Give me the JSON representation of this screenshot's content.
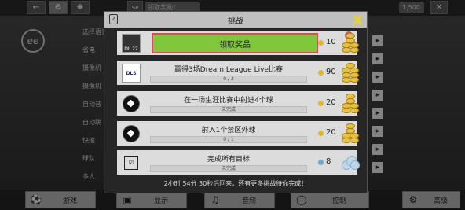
{
  "topbar": {
    "chip_label": "领取奖励！",
    "sp_badge": "SP",
    "currency_value": "1,500"
  },
  "logo": {
    "text": "ee"
  },
  "sidebar": {
    "items": [
      {
        "label": "选择语言"
      },
      {
        "label": "省电"
      },
      {
        "label": "摄像机"
      },
      {
        "label": "摄像机"
      },
      {
        "label": "自动音"
      },
      {
        "label": "自动跳"
      },
      {
        "label": "快速"
      },
      {
        "label": "球队"
      },
      {
        "label": "多人"
      }
    ]
  },
  "bottom_tabs": [
    {
      "label": "游戏",
      "icon": "football-icon"
    },
    {
      "label": "显示",
      "icon": "monitor-icon"
    },
    {
      "label": "音频",
      "icon": "music-icon"
    },
    {
      "label": "控制",
      "icon": "gamepad-icon"
    },
    {
      "label": "高级",
      "icon": "gear-icon"
    }
  ],
  "modal": {
    "title": "挑战",
    "close_label": "X",
    "footer": "2小时 54分 30秒后回来，还有更多挑战待你完成！",
    "challenges": [
      {
        "type": "claim",
        "button_label": "领取奖品",
        "badge": "!",
        "icon_text": "DL 22",
        "reward": "10",
        "reward_kind": "coin"
      },
      {
        "title": "赢得3场Dream League Live比赛",
        "progress": "0 / 3",
        "progress_fraction": 0,
        "icon_text": "DLS",
        "reward": "90",
        "reward_kind": "coin"
      },
      {
        "title": "在一场生涯比赛中射进4个球",
        "progress": "未完成",
        "progress_fraction": 0,
        "reward": "20",
        "reward_kind": "coin"
      },
      {
        "title": "射入1个禁区外球",
        "progress": "0 / 1",
        "progress_fraction": 0,
        "reward": "20",
        "reward_kind": "coin"
      },
      {
        "title": "完成所有目标",
        "progress": "未完成",
        "progress_fraction": 0,
        "reward": "8",
        "reward_kind": "gem"
      }
    ]
  }
}
